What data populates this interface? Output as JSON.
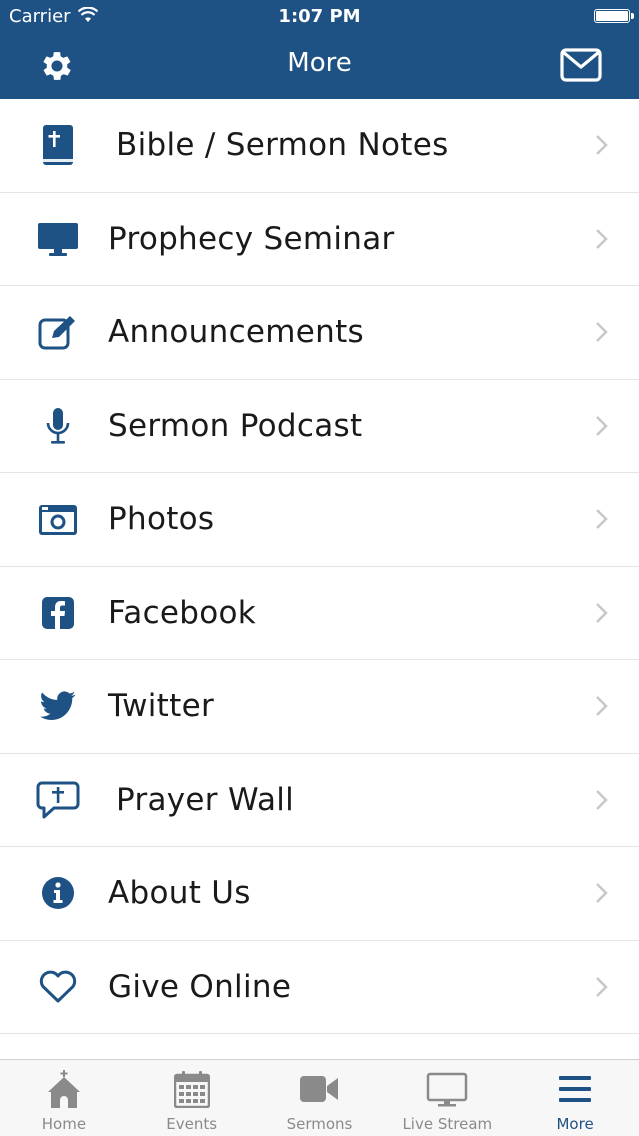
{
  "status_bar": {
    "carrier": "Carrier",
    "time": "1:07 PM"
  },
  "nav": {
    "title": "More",
    "settings_icon": "gear-icon",
    "mail_icon": "envelope-icon"
  },
  "colors": {
    "brand": "#1f5284",
    "icon": "#1f5284",
    "chevron": "#c7c7cc",
    "tab_inactive": "#8a8a8a"
  },
  "menu": [
    {
      "label": "Bible / Sermon Notes",
      "icon": "bible-icon"
    },
    {
      "label": "Prophecy Seminar",
      "icon": "monitor-icon"
    },
    {
      "label": "Announcements",
      "icon": "edit-icon"
    },
    {
      "label": "Sermon Podcast",
      "icon": "microphone-icon"
    },
    {
      "label": "Photos",
      "icon": "camera-icon"
    },
    {
      "label": "Facebook",
      "icon": "facebook-icon"
    },
    {
      "label": "Twitter",
      "icon": "twitter-icon"
    },
    {
      "label": "Prayer Wall",
      "icon": "prayer-bubble-icon"
    },
    {
      "label": "About Us",
      "icon": "info-icon"
    },
    {
      "label": "Give Online",
      "icon": "heart-icon"
    }
  ],
  "tabs": [
    {
      "label": "Home",
      "icon": "church-icon"
    },
    {
      "label": "Events",
      "icon": "calendar-icon"
    },
    {
      "label": "Sermons",
      "icon": "video-camera-icon"
    },
    {
      "label": "Live Stream",
      "icon": "tv-icon"
    },
    {
      "label": "More",
      "icon": "menu-icon",
      "active": true
    }
  ]
}
